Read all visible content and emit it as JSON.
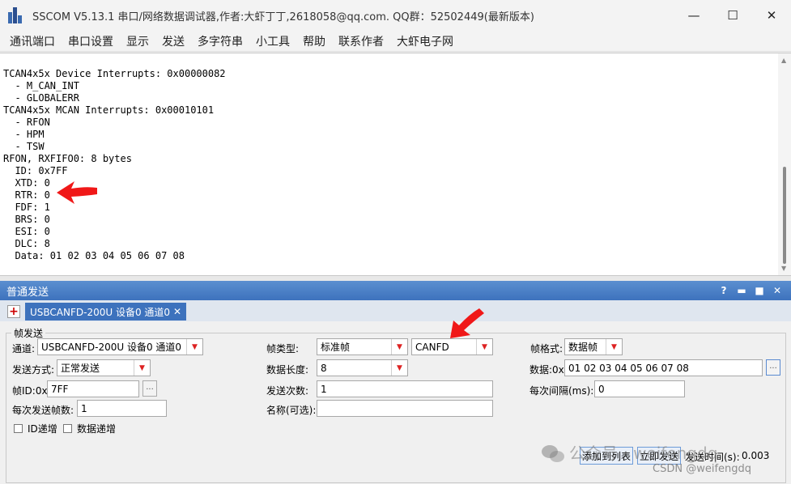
{
  "window": {
    "title": "SSCOM V5.13.1 串口/网络数据调试器,作者:大虾丁丁,2618058@qq.com. QQ群：52502449(最新版本)",
    "minimize": "—",
    "maximize": "☐",
    "close": "✕"
  },
  "menu": {
    "items": [
      "通讯端口",
      "串口设置",
      "显示",
      "发送",
      "多字符串",
      "小工具",
      "帮助",
      "联系作者",
      "大虾电子网"
    ]
  },
  "output": {
    "lines": [
      "TCAN4x5x Device Interrupts: 0x00000082",
      "  - M_CAN_INT",
      "  - GLOBALERR",
      "TCAN4x5x MCAN Interrupts: 0x00010101",
      "  - RFON",
      "  - HPM",
      "  - TSW",
      "RFON, RXFIFO0: 8 bytes",
      "  ID: 0x7FF",
      "  XTD: 0",
      "  RTR: 0",
      "  FDF: 1",
      "  BRS: 0",
      "  ESI: 0",
      "  DLC: 8",
      "  Data: 01 02 03 04 05 06 07 08"
    ]
  },
  "panel": {
    "title": "普通发送",
    "help": "?",
    "buttons": [
      "▬",
      "■",
      "✕"
    ]
  },
  "tab": {
    "add": "+",
    "label": "USBCANFD-200U 设备0 通道0",
    "close": "✕"
  },
  "form": {
    "legend": "帧发送",
    "channel_label": "通道:",
    "channel_value": "USBCANFD-200U 设备0 通道0",
    "frame_type_label": "帧类型:",
    "frame_type_value": "标准帧",
    "protocol_value": "CANFD",
    "frame_format_label": "帧格式:",
    "frame_format_value": "数据帧",
    "send_mode_label": "发送方式:",
    "send_mode_value": "正常发送",
    "data_length_label": "数据长度:",
    "data_length_value": "8",
    "data_label": "数据:0x",
    "data_value": "01 02 03 04 05 06 07 08",
    "frame_id_label": "帧ID:0x",
    "frame_id_value": "7FF",
    "send_count_label": "发送次数:",
    "send_count_value": "1",
    "interval_label": "每次间隔(ms):",
    "interval_value": "0",
    "frames_per_send_label": "每次发送帧数:",
    "frames_per_send_value": "1",
    "name_label": "名称(可选):",
    "name_value": "",
    "id_increment_label": "ID递增",
    "data_increment_label": "数据递增",
    "add_to_list_button": "添加到列表",
    "send_now_button": "立即发送",
    "send_time_label": "发送时间(s):",
    "send_time_value": "0.003",
    "ellipsis": "..."
  },
  "watermark": {
    "account": "公众号 · weifengdq",
    "csdn": "CSDN @weifengdq"
  },
  "colors": {
    "panel_header": "#3d72bd",
    "annotation_arrow": "#f01818",
    "dropdown_arrow": "#dd2222"
  }
}
